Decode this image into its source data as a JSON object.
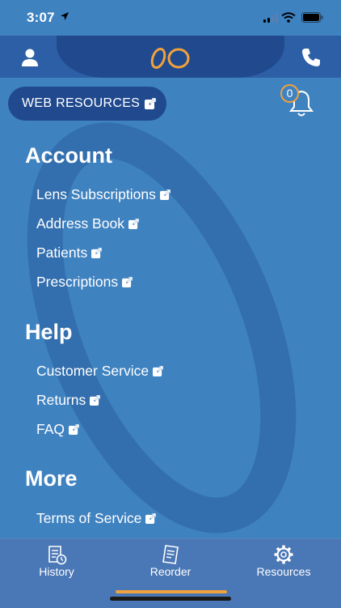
{
  "status_bar": {
    "time": "3:07"
  },
  "header": {
    "web_resources_label": "WEB RESOURCES",
    "notification_count": "0"
  },
  "menu": {
    "account": {
      "title": "Account",
      "items": [
        "Lens Subscriptions",
        "Address Book",
        "Patients",
        "Prescriptions"
      ]
    },
    "help": {
      "title": "Help",
      "items": [
        "Customer Service",
        "Returns",
        "FAQ"
      ]
    },
    "more": {
      "title": "More",
      "items": [
        "Terms of Service"
      ]
    }
  },
  "tabs": [
    {
      "label": "History",
      "icon": "history-icon"
    },
    {
      "label": "Reorder",
      "icon": "reorder-icon"
    },
    {
      "label": "Resources",
      "icon": "gear-icon"
    }
  ],
  "colors": {
    "background": "#3f82c0",
    "header": "#2d5fa6",
    "accent": "#f2a13b",
    "tabbar": "#4a77b5"
  }
}
